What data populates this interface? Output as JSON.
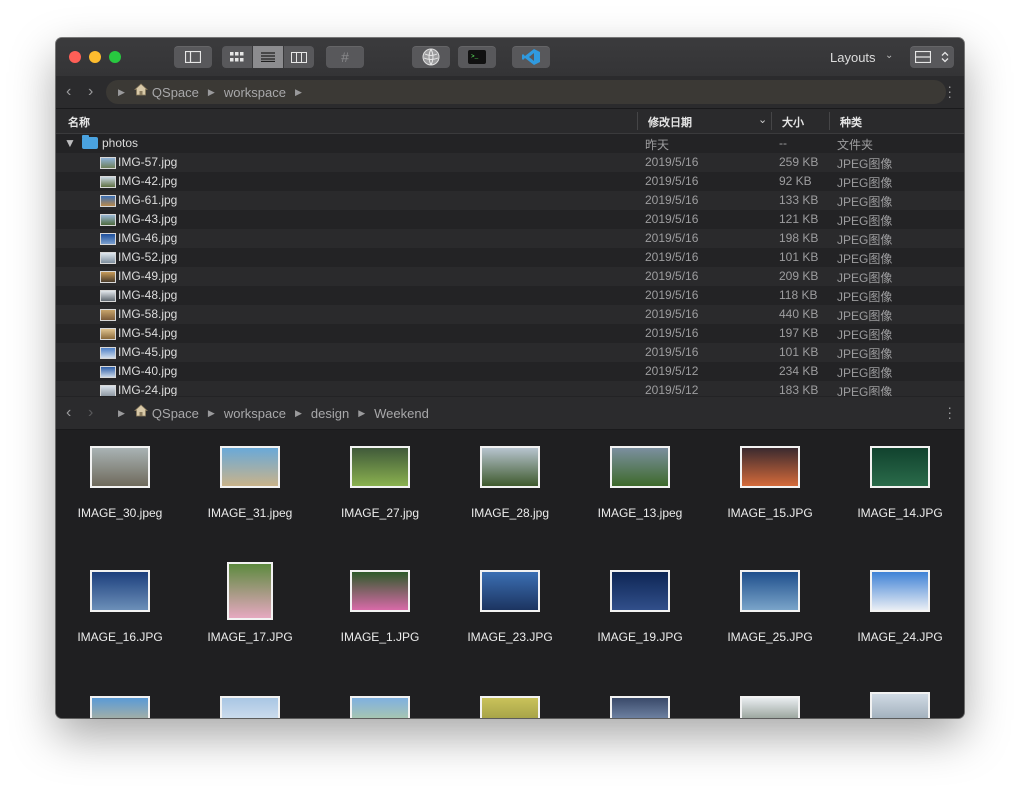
{
  "toolbar": {
    "layouts_label": "Layouts",
    "hash_label": "#"
  },
  "colors": {
    "close": "#ff5f57",
    "minimize": "#febc2e",
    "zoom": "#28c840",
    "folder": "#4aa3e0"
  },
  "top_pane": {
    "path": [
      "QSpace",
      "workspace"
    ],
    "columns": {
      "name": "名称",
      "date": "修改日期",
      "size": "大小",
      "kind": "种类"
    },
    "folder": {
      "name": "photos",
      "date": "昨天",
      "size": "--",
      "kind": "文件夹"
    },
    "rows": [
      {
        "name": "IMG-57.jpg",
        "date": "2019/5/16",
        "size": "259 KB",
        "kind": "JPEG图像"
      },
      {
        "name": "IMG-42.jpg",
        "date": "2019/5/16",
        "size": "92 KB",
        "kind": "JPEG图像"
      },
      {
        "name": "IMG-61.jpg",
        "date": "2019/5/16",
        "size": "133 KB",
        "kind": "JPEG图像"
      },
      {
        "name": "IMG-43.jpg",
        "date": "2019/5/16",
        "size": "121 KB",
        "kind": "JPEG图像"
      },
      {
        "name": "IMG-46.jpg",
        "date": "2019/5/16",
        "size": "198 KB",
        "kind": "JPEG图像"
      },
      {
        "name": "IMG-52.jpg",
        "date": "2019/5/16",
        "size": "101 KB",
        "kind": "JPEG图像"
      },
      {
        "name": "IMG-49.jpg",
        "date": "2019/5/16",
        "size": "209 KB",
        "kind": "JPEG图像"
      },
      {
        "name": "IMG-48.jpg",
        "date": "2019/5/16",
        "size": "118 KB",
        "kind": "JPEG图像"
      },
      {
        "name": "IMG-58.jpg",
        "date": "2019/5/16",
        "size": "440 KB",
        "kind": "JPEG图像"
      },
      {
        "name": "IMG-54.jpg",
        "date": "2019/5/16",
        "size": "197 KB",
        "kind": "JPEG图像"
      },
      {
        "name": "IMG-45.jpg",
        "date": "2019/5/16",
        "size": "101 KB",
        "kind": "JPEG图像"
      },
      {
        "name": "IMG-40.jpg",
        "date": "2019/5/12",
        "size": "234 KB",
        "kind": "JPEG图像"
      },
      {
        "name": "IMG-24.jpg",
        "date": "2019/5/12",
        "size": "183 KB",
        "kind": "JPEG图像"
      }
    ]
  },
  "bottom_pane": {
    "path": [
      "QSpace",
      "workspace",
      "design",
      "Weekend"
    ],
    "items": [
      "IMAGE_30.jpeg",
      "IMAGE_31.jpeg",
      "IMAGE_27.jpg",
      "IMAGE_28.jpg",
      "IMAGE_13.jpeg",
      "IMAGE_15.JPG",
      "IMAGE_14.JPG",
      "IMAGE_16.JPG",
      "IMAGE_17.JPG",
      "IMAGE_1.JPG",
      "IMAGE_23.JPG",
      "IMAGE_19.JPG",
      "IMAGE_25.JPG",
      "IMAGE_24.JPG"
    ]
  }
}
